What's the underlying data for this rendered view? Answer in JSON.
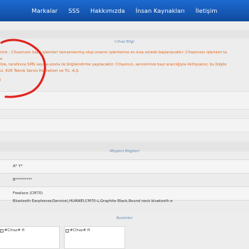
{
  "nav": {
    "items": [
      "Markalar",
      "SSS",
      "Hakkımızda",
      "İnsan Kaynakları",
      "İletişim"
    ]
  },
  "device_info": {
    "header": "Cihaz Bilgi",
    "lines": [
      "imiz ; Cihazınızın kayıt işlemleri tamamlanmış olup onarım işlemlerine en kısa sürede başlanacaktır. Cihazınızın işlemleri ta",
      "a",
      "lize, tarafınıza SMS veya e-posta ile bilgilendirme yapılacaktır. Cihazınızı, servisimize bayi aracılığıyla ilettiyseniz, bu bilgile",
      "ız. KVK Teknik Servis Hizmetleri ve Tic. A.Ş."
    ],
    "tail": "i"
  },
  "customer_info": {
    "header": "Müşteri Bilgileri",
    "name": "A* Y*",
    "phone": "B*********",
    "device": "Freelace (CM70)",
    "product": "Bluetooth Earphones(Service),HUAWEI,CM70-L,Graphite Black,Round neck bluetooth e"
  },
  "images": {
    "header": "Resimler",
    "alts": [
      "#Cihaz# H",
      "#Cihaz# H"
    ]
  },
  "colors": {
    "nav_blue": "#1659b6",
    "notice_orange": "#e26a1f",
    "annotation_red": "#e0231f"
  }
}
